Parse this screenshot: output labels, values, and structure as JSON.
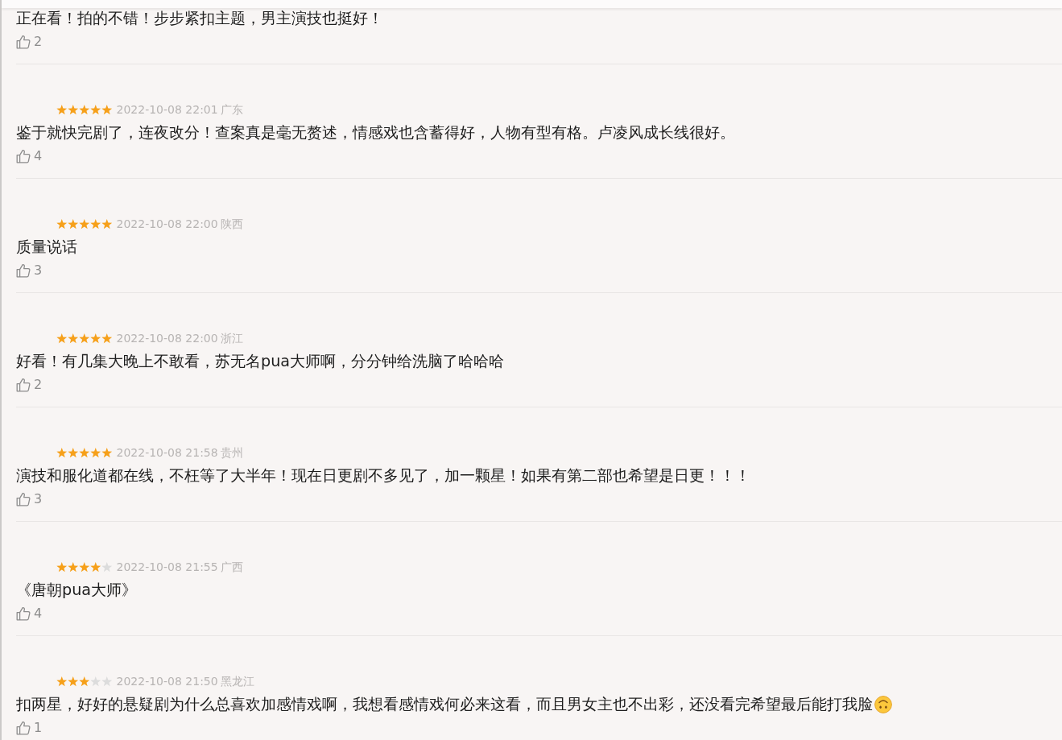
{
  "reviews": [
    {
      "text": "正在看！拍的不错！步步紧扣主题，男主演技也挺好！",
      "likes": "2"
    },
    {
      "stars": 5,
      "date": "2022-10-08 22:01",
      "region": "广东",
      "text": "鉴于就快完剧了，连夜改分！查案真是毫无赘述，情感戏也含蓄得好，人物有型有格。卢凌风成长线很好。",
      "likes": "4"
    },
    {
      "stars": 5,
      "date": "2022-10-08 22:00",
      "region": "陕西",
      "text": "质量说话",
      "likes": "3"
    },
    {
      "stars": 5,
      "date": "2022-10-08 22:00",
      "region": "浙江",
      "text": "好看！有几集大晚上不敢看，苏无名pua大师啊，分分钟给洗脑了哈哈哈",
      "likes": "2"
    },
    {
      "stars": 5,
      "date": "2022-10-08 21:58",
      "region": "贵州",
      "text": "演技和服化道都在线，不枉等了大半年！现在日更剧不多见了，加一颗星！如果有第二部也希望是日更！！！",
      "likes": "3"
    },
    {
      "stars": 4,
      "date": "2022-10-08 21:55",
      "region": "广西",
      "text": "《唐朝pua大师》",
      "likes": "4"
    },
    {
      "stars": 3,
      "date": "2022-10-08 21:50",
      "region": "黑龙江",
      "text": "扣两星，好好的悬疑剧为什么总喜欢加感情戏啊，我想看感情戏何必来这看，而且男女主也不出彩，还没看完希望最后能打我脸",
      "has_emoji": true,
      "likes": "1"
    }
  ]
}
